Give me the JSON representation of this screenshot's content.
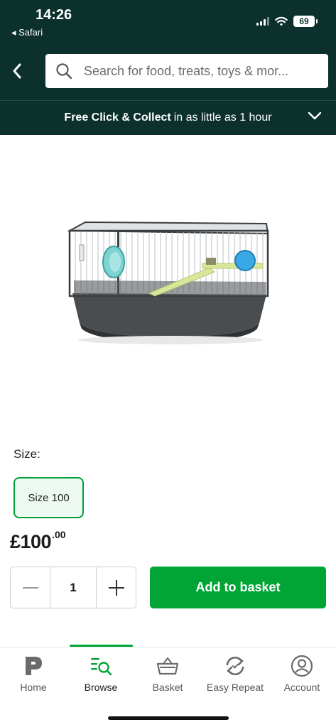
{
  "status_bar": {
    "time": "14:26",
    "back_app": "◂ Safari",
    "battery": "69"
  },
  "header": {
    "search_placeholder": "Search for food, treats, toys & mor..."
  },
  "promo": {
    "bold": "Free Click & Collect",
    "rest": "in as little as 1 hour"
  },
  "product": {
    "size_label": "Size:",
    "selected_size": "Size 100",
    "price_main": "£100",
    "price_pence": ".00",
    "quantity": "1",
    "add_to_basket": "Add to basket"
  },
  "nav": {
    "items": [
      {
        "label": "Home",
        "icon": "home-logo-icon"
      },
      {
        "label": "Browse",
        "icon": "browse-search-icon"
      },
      {
        "label": "Basket",
        "icon": "basket-icon"
      },
      {
        "label": "Easy Repeat",
        "icon": "repeat-icon"
      },
      {
        "label": "Account",
        "icon": "account-icon"
      }
    ],
    "active": "Browse"
  },
  "colors": {
    "header_bg": "#0c312c",
    "accent_green": "#00a535"
  }
}
